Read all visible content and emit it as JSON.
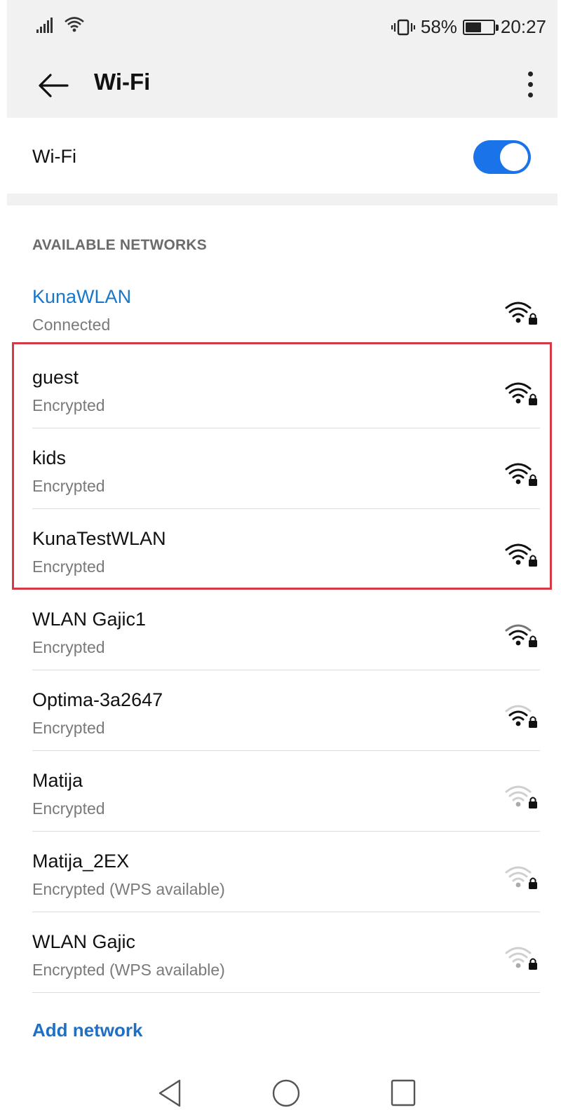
{
  "status_bar": {
    "battery_percent": "58%",
    "battery_level": 0.58,
    "time": "20:27"
  },
  "app_bar": {
    "title": "Wi-Fi",
    "back_icon": "arrow-left-icon",
    "more_icon": "more-vertical-icon"
  },
  "wifi_toggle": {
    "label": "Wi-Fi",
    "enabled": true,
    "accent": "#1a73e8"
  },
  "section_header": "AVAILABLE NETWORKS",
  "networks": [
    {
      "name": "KunaWLAN",
      "status": "Connected",
      "signal": "full",
      "locked": true,
      "connected": true
    },
    {
      "name": "guest",
      "status": "Encrypted",
      "signal": "full",
      "locked": true
    },
    {
      "name": "kids",
      "status": "Encrypted",
      "signal": "full",
      "locked": true
    },
    {
      "name": "KunaTestWLAN",
      "status": "Encrypted",
      "signal": "full",
      "locked": true
    },
    {
      "name": "WLAN Gajic1",
      "status": "Encrypted",
      "signal": "strong",
      "locked": true
    },
    {
      "name": "Optima-3a2647",
      "status": "Encrypted",
      "signal": "medium",
      "locked": true
    },
    {
      "name": "Matija",
      "status": "Encrypted",
      "signal": "weak",
      "locked": true
    },
    {
      "name": "Matija_2EX",
      "status": "Encrypted (WPS available)",
      "signal": "weak",
      "locked": true
    },
    {
      "name": "WLAN Gajic",
      "status": "Encrypted (WPS available)",
      "signal": "weak",
      "locked": true
    }
  ],
  "add_network_label": "Add network",
  "colors": {
    "connected": "#1877c9",
    "highlight_border": "#d33a45",
    "link": "#1f6fc5"
  },
  "nav_bar": {
    "back": "triangle-back-icon",
    "home": "circle-home-icon",
    "recents": "square-recents-icon"
  }
}
